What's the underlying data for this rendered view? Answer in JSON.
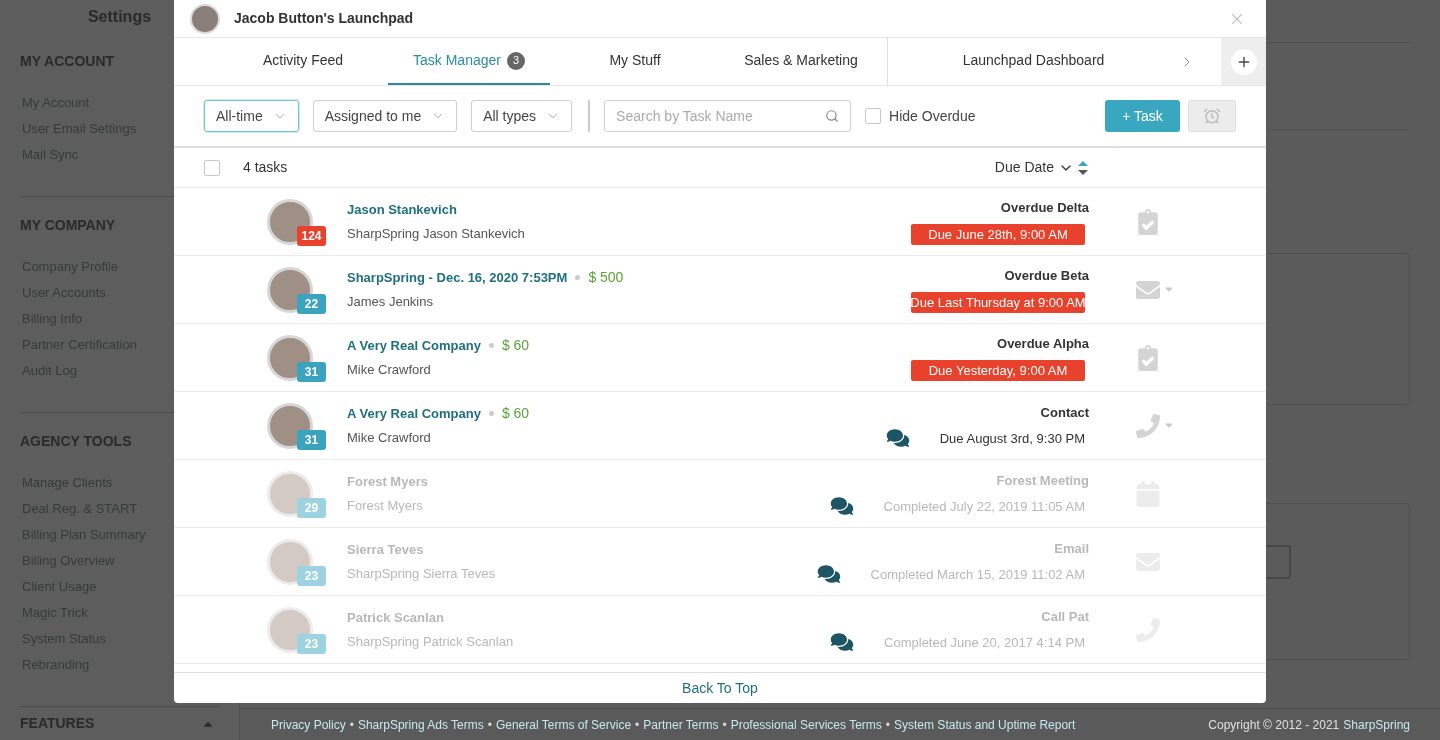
{
  "settings": {
    "title": "Settings",
    "sections": [
      {
        "heading": "MY ACCOUNT",
        "items": [
          "My Account",
          "User Email Settings",
          "Mail Sync"
        ]
      },
      {
        "heading": "MY COMPANY",
        "items": [
          "Company Profile",
          "User Accounts",
          "Billing Info",
          "Partner Certification",
          "Audit Log"
        ]
      },
      {
        "heading": "AGENCY TOOLS",
        "items": [
          "Manage Clients",
          "Deal Reg. & START",
          "Billing Plan Summary",
          "Billing Overview",
          "Client Usage",
          "Magic Trick",
          "System Status",
          "Rebranding"
        ]
      }
    ],
    "collapsed_section": "FEATURES"
  },
  "footer": {
    "separator": "•",
    "links": [
      "Privacy Policy",
      "SharpSpring Ads Terms",
      "General Terms of Service",
      "Partner Terms",
      "Professional Services Terms",
      "System Status and Uptime Report"
    ],
    "copyright": "Copyright © 2012 - 2021",
    "brand": "SharpSpring"
  },
  "modal": {
    "title": "Jacob Button's Launchpad",
    "tabs": [
      {
        "label": "Activity Feed",
        "selected": false
      },
      {
        "label": "Task Manager",
        "selected": true,
        "count": "3"
      },
      {
        "label": "My Stuff",
        "selected": false
      },
      {
        "label": "Sales & Marketing",
        "selected": false
      }
    ],
    "dashboard_tab": {
      "label": "Launchpad Dashboard",
      "selected": false
    },
    "filters": [
      {
        "label": "All-time",
        "focused": true
      },
      {
        "label": "Assigned to me",
        "focused": false
      },
      {
        "label": "All types",
        "focused": false
      }
    ],
    "search": {
      "placeholder": "Search by Task Name"
    },
    "hide_overdue": {
      "label": "Hide Overdue",
      "checked": false
    },
    "add_button": "+ Task",
    "list_header": {
      "count": "4 tasks",
      "checked": false,
      "sort": "Due Date"
    },
    "tasks": [
      {
        "title": "Jason Stankevich",
        "subtitle": "SharpSpring Jason Stankevich",
        "badge": {
          "text": "124",
          "color": "#e8412c"
        },
        "task": "Overdue Delta",
        "due": "Due June 28th, 9:00 AM",
        "overdue": true,
        "completed": false,
        "has_comments": false,
        "kind": "task",
        "has_menu": false
      },
      {
        "title": "SharpSpring - Dec. 16, 2020 7:53PM",
        "amount": "$ 500",
        "subtitle": "James Jenkins",
        "badge": {
          "text": "22",
          "color": "#3ba3bd"
        },
        "task": "Overdue Beta",
        "due": "Due Last Thursday at 9:00 AM",
        "overdue": true,
        "completed": false,
        "has_comments": false,
        "kind": "email",
        "has_menu": true
      },
      {
        "title": "A Very Real Company",
        "amount": "$ 60",
        "subtitle": "Mike Crawford",
        "badge": {
          "text": "31",
          "color": "#3ba3bd"
        },
        "task": "Overdue Alpha",
        "due": "Due Yesterday, 9:00 AM",
        "overdue": true,
        "completed": false,
        "has_comments": false,
        "kind": "task",
        "has_menu": false
      },
      {
        "title": "A Very Real Company",
        "amount": "$ 60",
        "subtitle": "Mike Crawford",
        "badge": {
          "text": "31",
          "color": "#3ba3bd"
        },
        "task": "Contact",
        "due": "Due August 3rd, 9:30 PM",
        "overdue": false,
        "completed": false,
        "has_comments": true,
        "kind": "phone",
        "has_menu": true
      },
      {
        "title": "Forest Myers",
        "subtitle": "Forest Myers",
        "badge": {
          "text": "29",
          "color": "#9dd3e0"
        },
        "task": "Forest Meeting",
        "due": "Completed July 22, 2019 11:05 AM",
        "overdue": false,
        "completed": true,
        "has_comments": true,
        "kind": "meeting",
        "has_menu": false
      },
      {
        "title": "Sierra Teves",
        "subtitle": "SharpSpring Sierra Teves",
        "badge": {
          "text": "23",
          "color": "#9dd3e0"
        },
        "task": "Email",
        "due": "Completed March 15, 2019 11:02 AM",
        "overdue": false,
        "completed": true,
        "has_comments": true,
        "kind": "email",
        "has_menu": false
      },
      {
        "title": "Patrick Scanlan",
        "subtitle": "SharpSpring Patrick Scanlan",
        "badge": {
          "text": "23",
          "color": "#9dd3e0"
        },
        "task": "Call Pat",
        "due": "Completed June 20, 2017 4:14 PM",
        "overdue": false,
        "completed": true,
        "has_comments": true,
        "kind": "phone",
        "has_menu": false
      }
    ],
    "back_to_top": "Back To Top"
  }
}
